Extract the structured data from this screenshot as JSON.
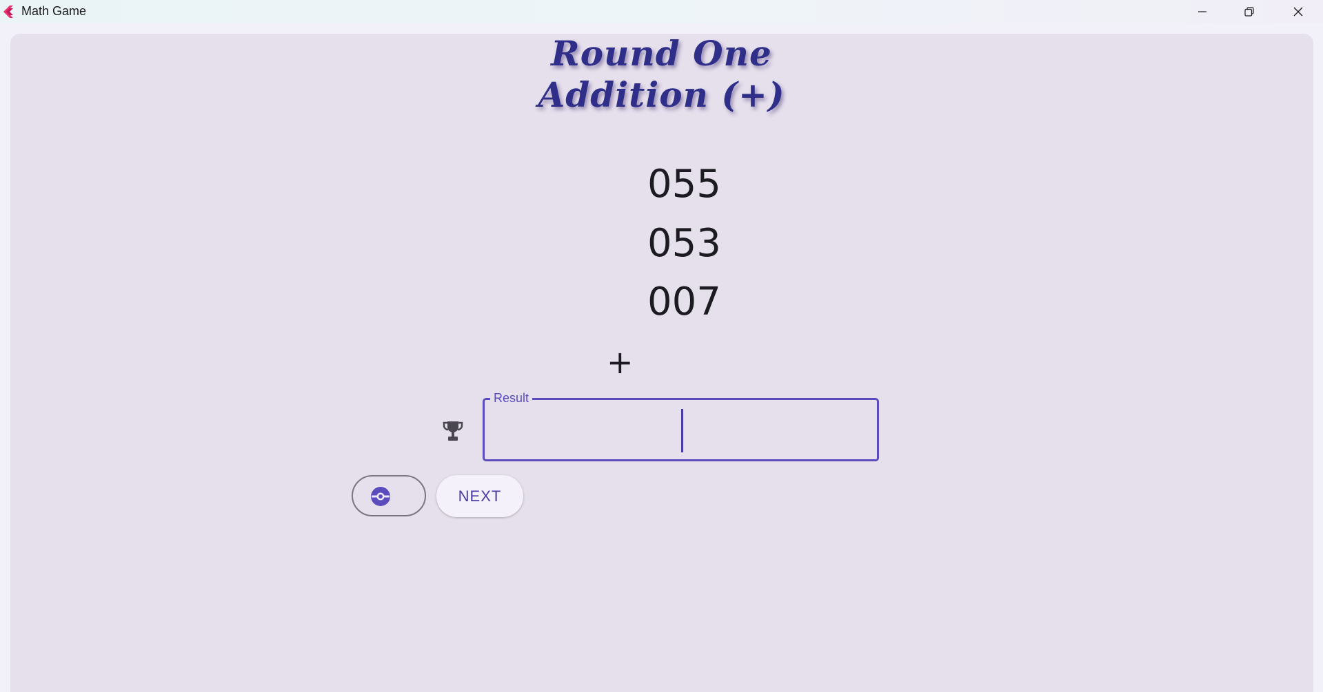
{
  "window": {
    "title": "Math Game",
    "app_icon": "flutter-app-icon",
    "controls": {
      "minimize_icon": "minimize-icon",
      "maximize_icon": "restore-icon",
      "close_icon": "close-icon"
    }
  },
  "game": {
    "round_title": "Round One",
    "operation_title": "Addition (+)",
    "numbers": [
      "055",
      "053",
      "007"
    ],
    "operator": "+",
    "result": {
      "label": "Result",
      "value": ""
    },
    "icons": {
      "trophy": "trophy-icon",
      "hint": "hint-icon"
    },
    "next_label": "NEXT"
  },
  "colors": {
    "heading": "#2f2f8a",
    "accent": "#5a4cbd",
    "background": "#e6e0ec"
  }
}
